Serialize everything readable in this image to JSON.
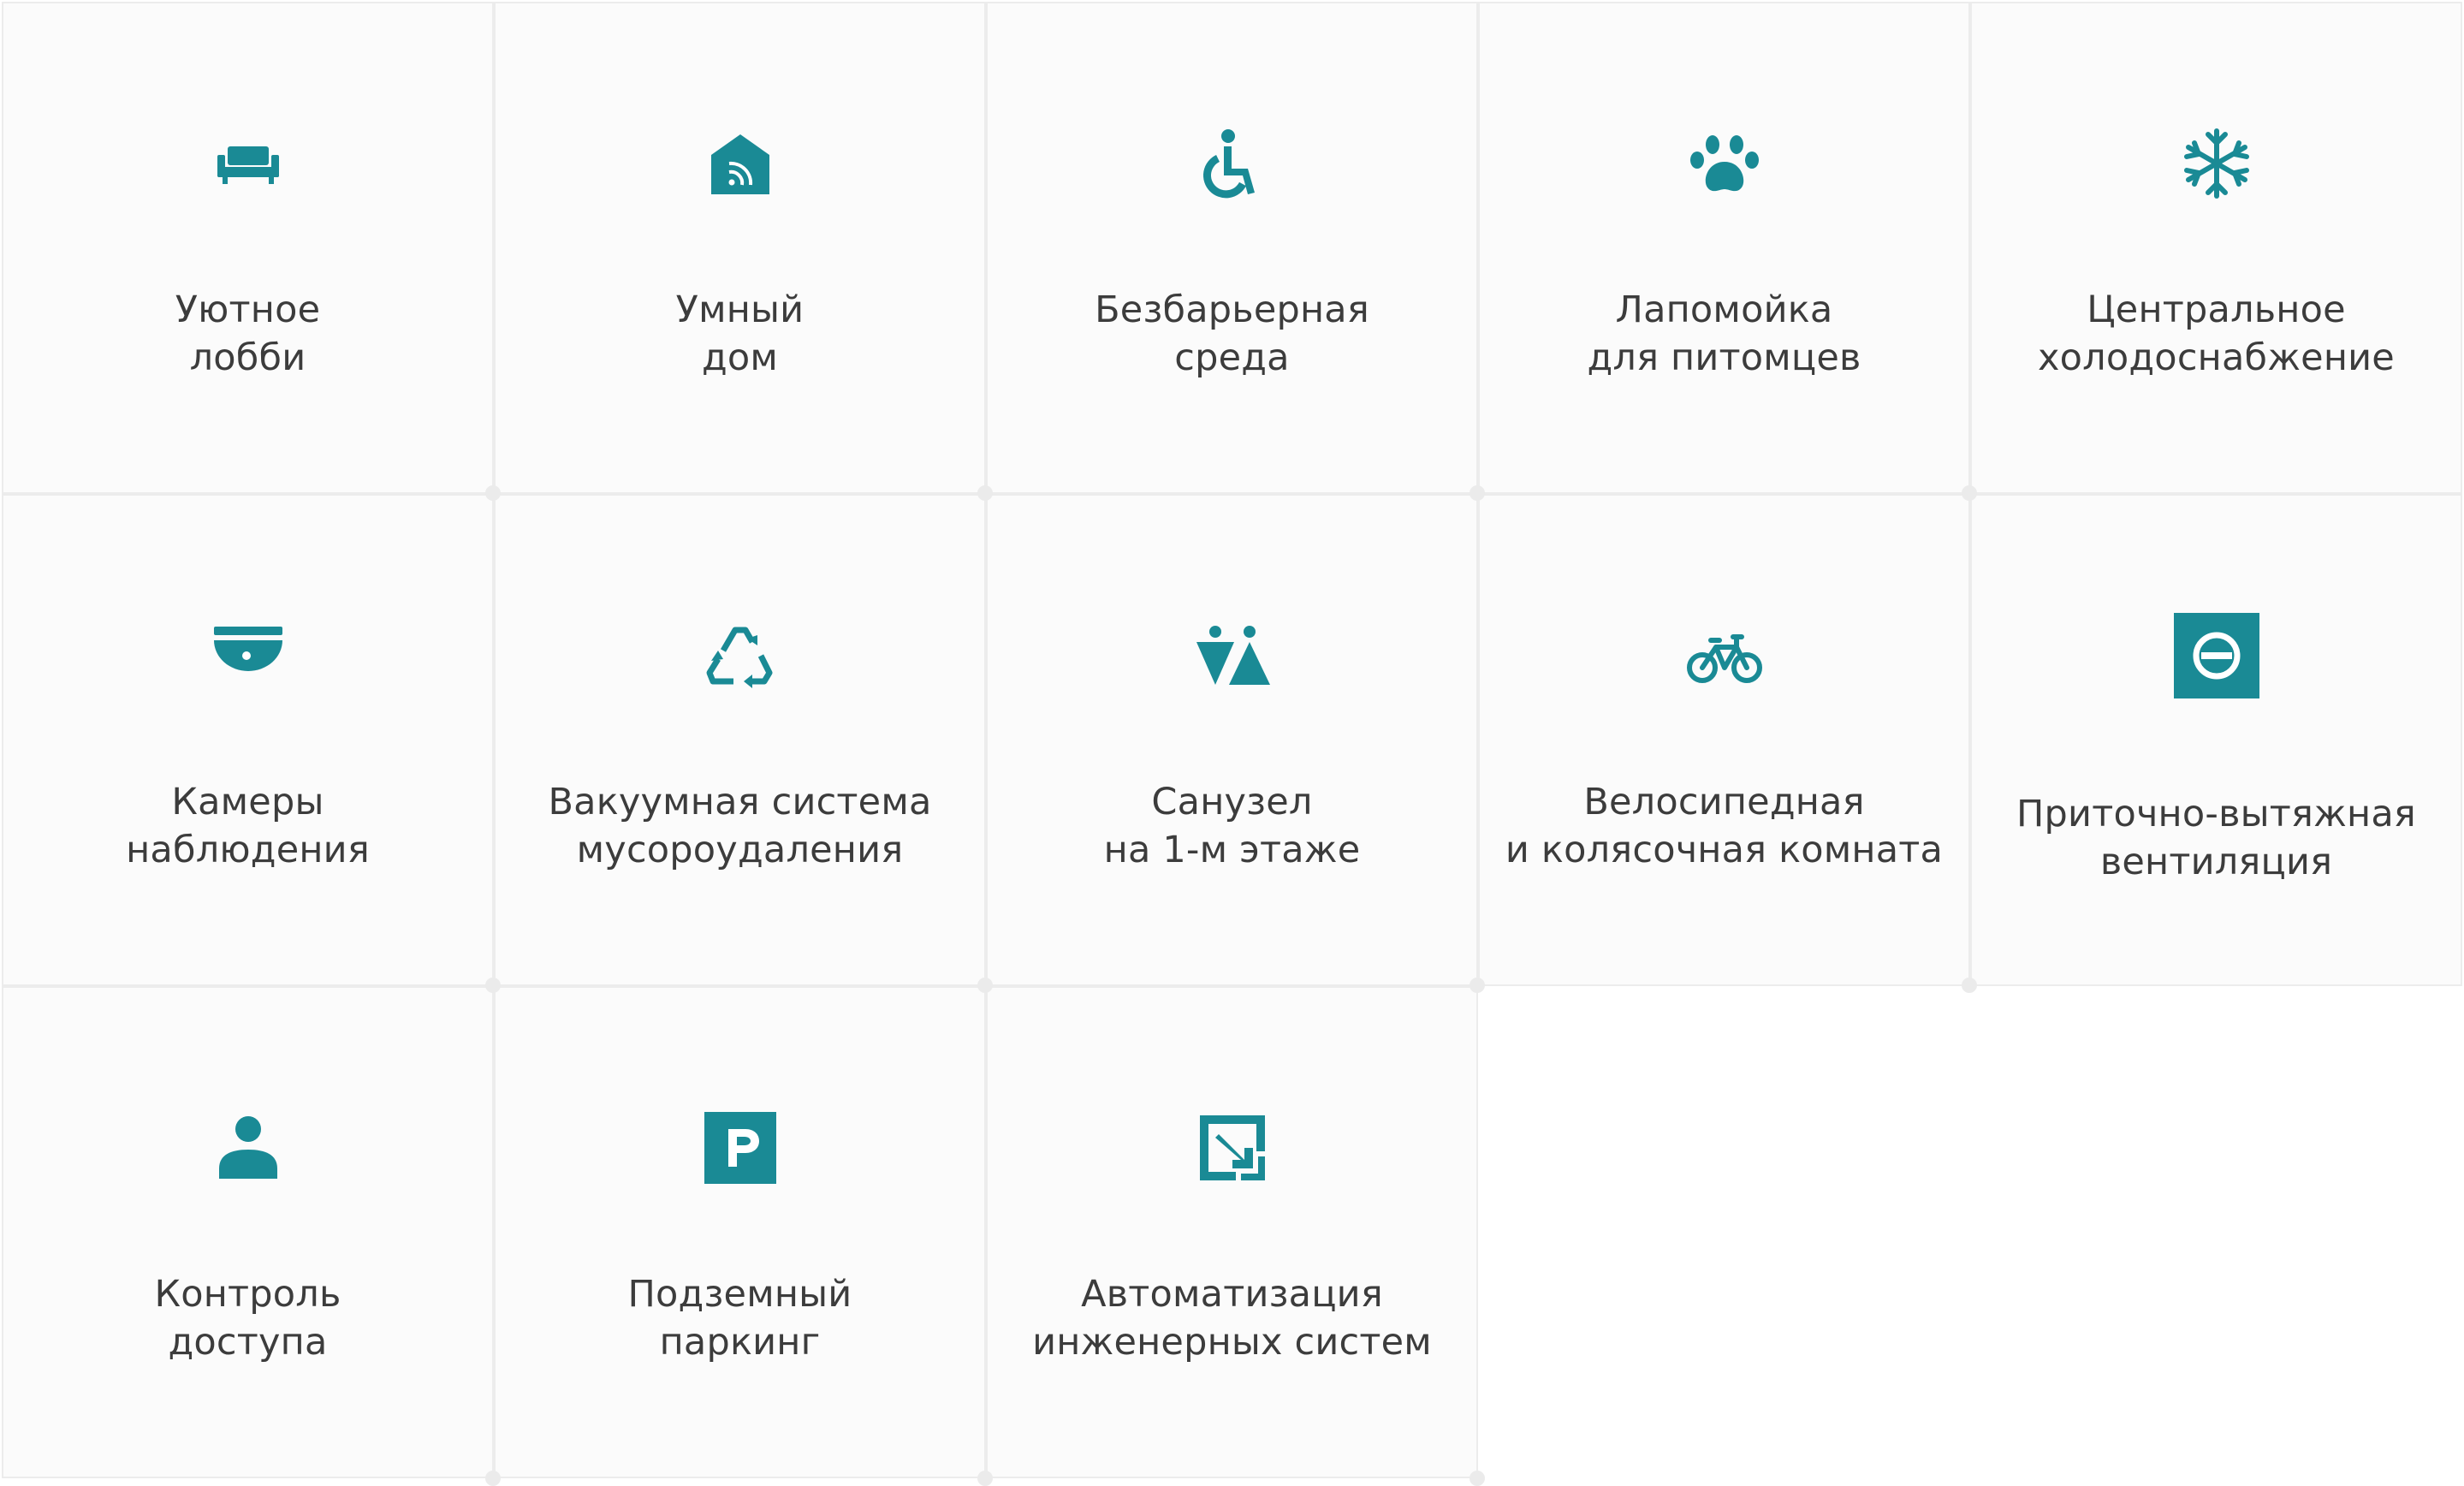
{
  "accent_color": "#1a8a95",
  "features": [
    {
      "icon": "sofa-icon",
      "line1": "Уютное",
      "line2": "лобби"
    },
    {
      "icon": "smart-home-icon",
      "line1": "Умный",
      "line2": "дом"
    },
    {
      "icon": "wheelchair-icon",
      "line1": "Безбарьерная",
      "line2": "среда"
    },
    {
      "icon": "paw-icon",
      "line1": "Лапомойка",
      "line2": "для питомцев"
    },
    {
      "icon": "snowflake-icon",
      "line1": "Центральное",
      "line2": "холодоснабжение"
    },
    {
      "icon": "camera-icon",
      "line1": "Камеры",
      "line2": "наблюдения"
    },
    {
      "icon": "recycle-icon",
      "line1": "Вакуумная система",
      "line2": "мусороудаления"
    },
    {
      "icon": "restroom-icon",
      "line1": "Санузел",
      "line2": "на 1-м этаже"
    },
    {
      "icon": "bicycle-icon",
      "line1": "Велосипедная",
      "line2": "и колясочная комната"
    },
    {
      "icon": "ventilation-icon",
      "line1": "Приточно-вытяжная",
      "line2": "вентиляция"
    },
    {
      "icon": "person-icon",
      "line1": "Контроль",
      "line2": "доступа"
    },
    {
      "icon": "parking-icon",
      "line1": "Подземный",
      "line2": "паркинг"
    },
    {
      "icon": "automation-icon",
      "line1": "Автоматизация",
      "line2": "инженерных систем"
    }
  ]
}
